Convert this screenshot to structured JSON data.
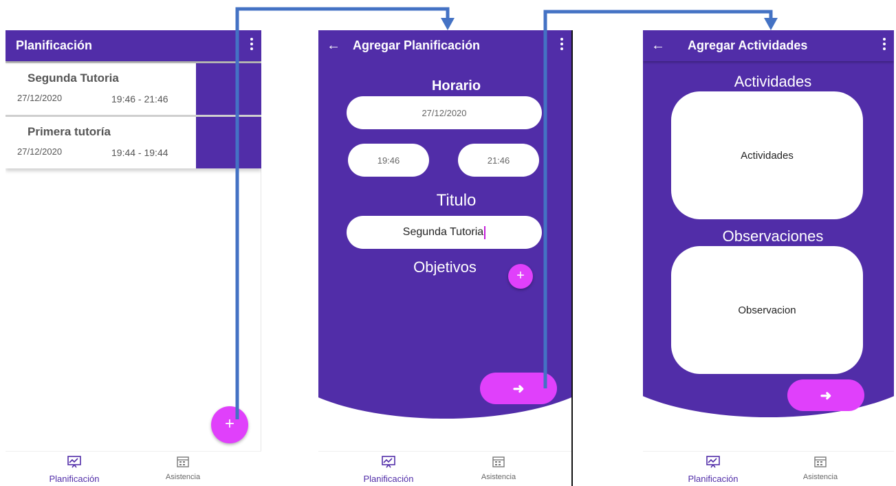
{
  "screen1": {
    "title": "Planificación",
    "items": [
      {
        "title": "Segunda Tutoria",
        "date": "27/12/2020",
        "time": "19:46 - 21:46"
      },
      {
        "title": "Primera tutoría",
        "date": "27/12/2020",
        "time": "19:44 - 19:44"
      }
    ],
    "fab_label": "+"
  },
  "screen2": {
    "title": "Agregar Planificación",
    "horario_label": "Horario",
    "date_value": "27/12/2020",
    "start_time": "19:46",
    "end_time": "21:46",
    "titulo_label": "Titulo",
    "titulo_value": "Segunda Tutoria",
    "objetivos_label": "Objetivos",
    "add_label": "+",
    "next_label": "➜"
  },
  "screen3": {
    "title": "Agregar Actividades",
    "actividades_label": "Actividades",
    "actividades_placeholder": "Actividades",
    "observaciones_label": "Observaciones",
    "observaciones_placeholder": "Observacion",
    "next_label": "➜"
  },
  "nav": {
    "planificacion": "Planificación",
    "asistencia": "Asistencia"
  },
  "icons": {
    "back": "arrow-left-icon",
    "menu": "more-vert-icon",
    "planificacion": "chart-presentation-icon",
    "asistencia": "calendar-grid-icon"
  },
  "colors": {
    "primary": "#512da8",
    "accent": "#e040fb",
    "connector": "#4472c4"
  }
}
